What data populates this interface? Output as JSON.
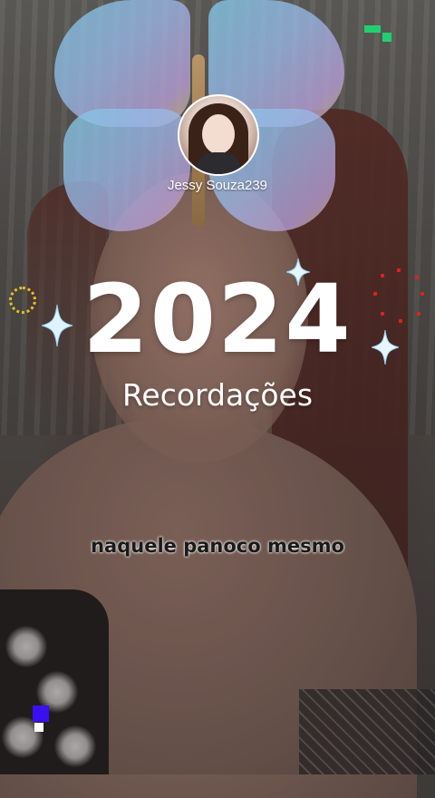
{
  "profile": {
    "username": "Jessy Souza239"
  },
  "title": {
    "year": "2024",
    "subtitle": "Recordações"
  },
  "caption": {
    "text": "naquele panoco mesmo"
  },
  "colors": {
    "text_primary": "#ffffff",
    "caption_text": "#1a1a1a",
    "accent_yellow": "#e8c020",
    "accent_red": "#e02020",
    "accent_green": "#20d070",
    "accent_purple": "#3a10f0"
  },
  "icons": [
    "butterfly-filter-icon",
    "sparkle-icon",
    "gear-ring-icon"
  ]
}
